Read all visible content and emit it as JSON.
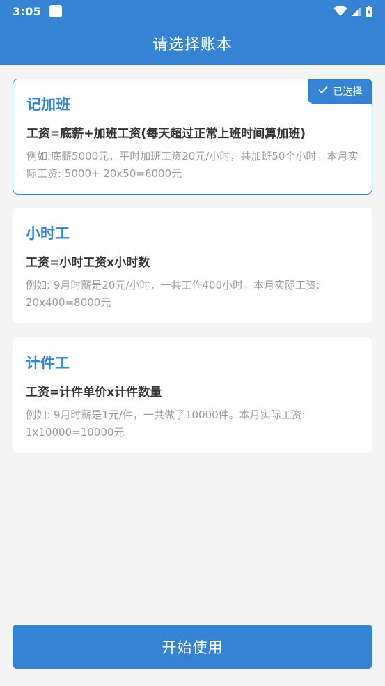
{
  "status": {
    "time": "3:05",
    "icons": [
      "notification-icon",
      "wifi-icon",
      "signal-icon",
      "battery-icon"
    ]
  },
  "header": {
    "title": "请选择账本"
  },
  "cards": [
    {
      "title": "记加班",
      "formula": "工资=底薪+加班工资(每天超过正常上班时间算加班)",
      "example": "例如:底薪5000元，平时加班工资20元/小时，共加班50个小时。本月实际工资: 5000+ 20x50=6000元",
      "selected": true,
      "badge": "已选择"
    },
    {
      "title": "小时工",
      "formula": "工资=小时工资x小时数",
      "example": "例如: 9月时薪是20元/小时，一共工作400小时。本月实际工资: 20x400=8000元",
      "selected": false
    },
    {
      "title": "计件工",
      "formula": "工资=计件单价x计件数量",
      "example": "例如: 9月时薪是1元/件，一共做了10000件。本月实际工资: 1x10000=10000元",
      "selected": false
    }
  ],
  "footer": {
    "start_label": "开始使用"
  },
  "colors": {
    "accent": "#3484d3",
    "background": "#f4f4f4"
  }
}
